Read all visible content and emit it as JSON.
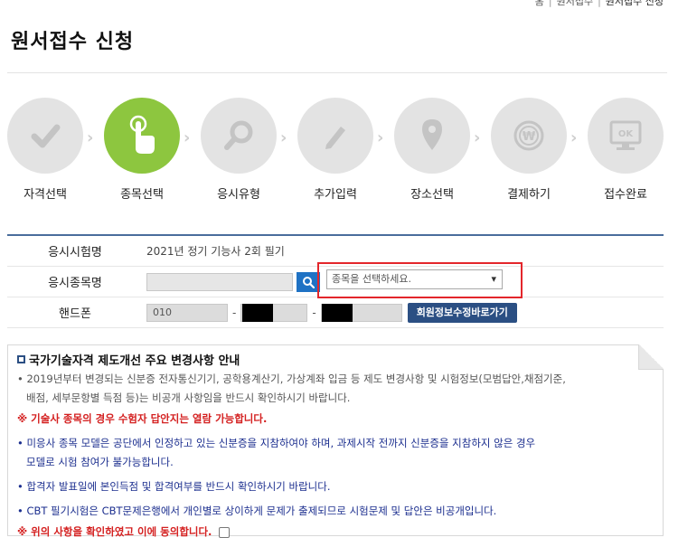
{
  "breadcrumb": [
    "홈",
    "원서접수",
    "원서접수 신청"
  ],
  "page_title": "원서접수 신청",
  "steps": [
    {
      "label": "자격선택",
      "icon": "check-icon",
      "active": false
    },
    {
      "label": "종목선택",
      "icon": "pointer-hand-icon",
      "active": true
    },
    {
      "label": "응시유형",
      "icon": "magnifier-icon",
      "active": false
    },
    {
      "label": "추가입력",
      "icon": "pencil-icon",
      "active": false
    },
    {
      "label": "장소선택",
      "icon": "location-pin-icon",
      "active": false
    },
    {
      "label": "결제하기",
      "icon": "won-coin-icon",
      "active": false
    },
    {
      "label": "접수완료",
      "icon": "ok-monitor-icon",
      "active": false
    }
  ],
  "form": {
    "exam_name_label": "응시시험명",
    "exam_name_value": "2021년 정기 기능사 2회 필기",
    "subject_label": "응시종목명",
    "subject_select_value": "종목을 선택하세요.",
    "phone_label": "핸드폰",
    "phone_prefix": "010",
    "phone_dash": "-",
    "edit_member_button": "회원정보수정바로가기"
  },
  "notice": {
    "title": "국가기술자격 제도개선 주요 변경사항 안내",
    "line1a": "• 2019년부터 변경되는 신분증 전자통신기기, 공학용계산기, 가상계좌 입금 등 제도 변경사항 및 시험정보(모범답안,채점기준,",
    "line1b": "배점, 세부문항별 득점 등)는 비공개 사항임을 반드시 확인하시기 바랍니다.",
    "line2": "※ 기술사 종목의 경우 수험자 답안지는 열람 가능합니다.",
    "line3a": "• 미응사 종목 모델은 공단에서 인정하고 있는 신분증을 지참하여야 하며, 과제시작 전까지 신분증을 지참하지 않은 경우",
    "line3b": "모델로 시험 참여가 불가능합니다.",
    "line4": "• 합격자 발표일에 본인득점 및 합격여부를 반드시 확인하시기 바랍니다.",
    "line5": "• CBT 필기시험은 CBT문제은행에서 개인별로 상이하게 문제가 출제되므로 시험문제 및 답안은 비공개입니다.",
    "agree": "※ 위의 사항을 확인하였고 이에 동의합니다."
  },
  "colors": {
    "active_step": "#8dc63f",
    "inactive_step": "#e3e3e3",
    "accent": "#2b4f83",
    "highlight": "#e3262b",
    "search_button": "#1f72c4"
  }
}
